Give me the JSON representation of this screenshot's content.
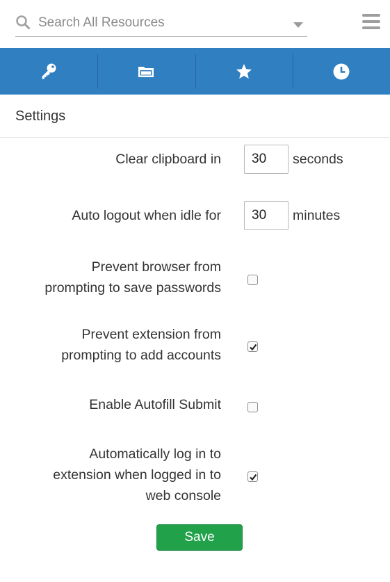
{
  "search": {
    "placeholder": "Search All Resources",
    "value": ""
  },
  "nav": {
    "tabs": [
      {
        "icon": "key-icon"
      },
      {
        "icon": "folder-icon"
      },
      {
        "icon": "star-icon"
      },
      {
        "icon": "clock-icon"
      }
    ],
    "color": "#2f7fc1"
  },
  "settings": {
    "title": "Settings",
    "clear_clipboard": {
      "label": "Clear clipboard in",
      "value": "30",
      "unit": "seconds"
    },
    "auto_logout": {
      "label": "Auto logout when idle for",
      "value": "30",
      "unit": "minutes"
    },
    "prevent_browser_save": {
      "line1": "Prevent browser from",
      "line2": "prompting to save passwords",
      "checked": false
    },
    "prevent_extension_add": {
      "line1": "Prevent extension from",
      "line2": "prompting to add accounts",
      "checked": true
    },
    "autofill_submit": {
      "label": "Enable Autofill Submit",
      "checked": false
    },
    "auto_login": {
      "line1": "Automatically log in to",
      "line2": "extension when logged in to",
      "line3": "web console",
      "checked": true
    },
    "save_label": "Save",
    "save_color": "#20a14a"
  }
}
